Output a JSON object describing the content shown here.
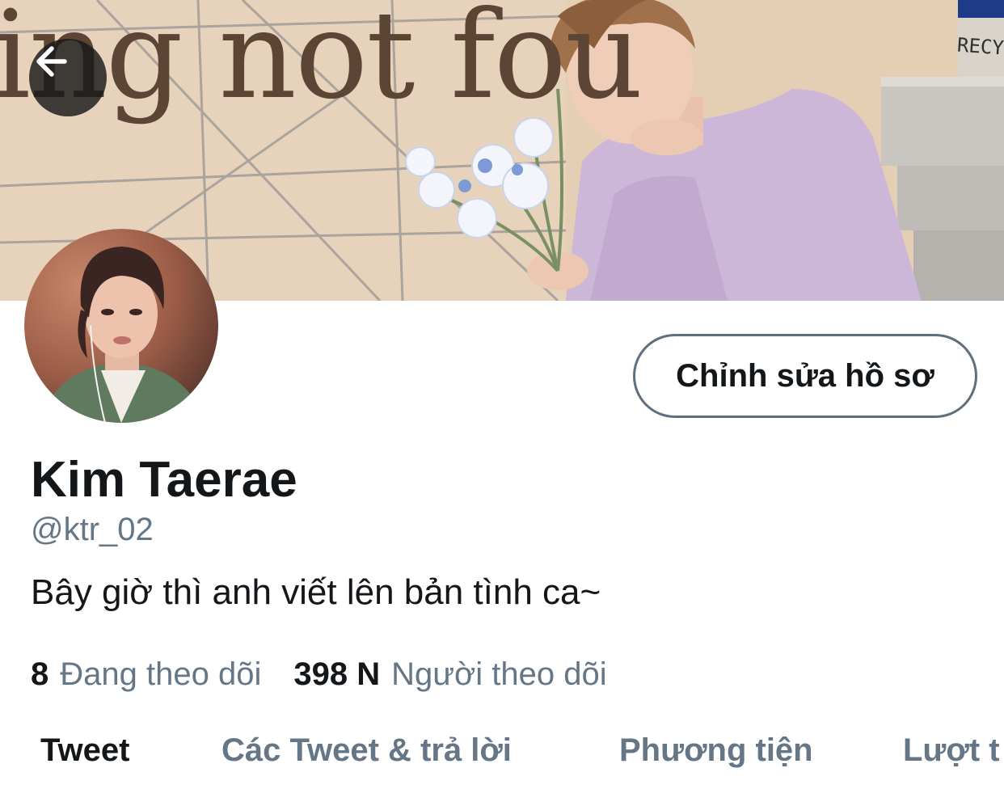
{
  "banner": {
    "overlay_text": "ing not fou",
    "sign_text": "RECYC"
  },
  "nav": {
    "back_icon": "arrow-left-icon"
  },
  "profile": {
    "edit_button_label": "Chỉnh sửa hồ sơ",
    "display_name": "Kim Taerae",
    "handle": "@ktr_02",
    "bio": "Bây giờ thì anh viết lên bản tình ca~",
    "following_count": "8",
    "following_label": "Đang theo dõi",
    "followers_count": "398 N",
    "followers_label": "Người theo dõi"
  },
  "tabs": [
    {
      "label": "Tweet",
      "active": true
    },
    {
      "label": "Các Tweet & trả lời",
      "active": false
    },
    {
      "label": "Phương tiện",
      "active": false
    },
    {
      "label": "Lượt t",
      "active": false
    }
  ],
  "colors": {
    "text_primary": "#14171a",
    "text_secondary": "#657786",
    "button_border": "#5f6f7e",
    "background": "#ffffff"
  }
}
